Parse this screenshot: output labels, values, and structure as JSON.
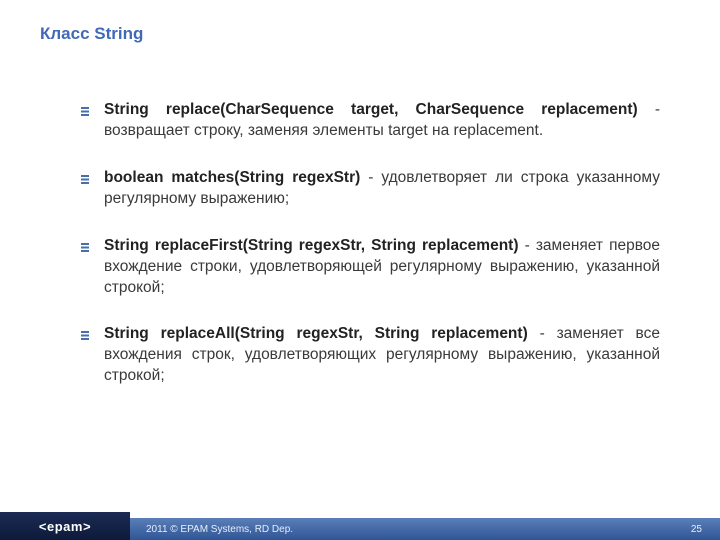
{
  "title": "Класс String",
  "items": [
    {
      "sig": "String replace(CharSequence target, CharSequence replacement)",
      "sep": " - ",
      "desc": "возвращает строку, заменяя элементы target на replacement."
    },
    {
      "sig": "boolean matches(String regexStr)",
      "sep": " - ",
      "desc": "удовлетворяет ли строка указанному регулярному выражению;"
    },
    {
      "sig": "String replaceFirst(String regexStr, String replacement)",
      "sep": " - ",
      "desc": "заменяет первое вхождение строки, удовлетворяющей регулярному выражению, указанной строкой;"
    },
    {
      "sig": "String replaceAll(String regexStr, String replacement)",
      "sep": " - ",
      "desc": "заменяет все вхождения строк, удовлетворяющих регулярному выражению, указанной строкой;"
    }
  ],
  "footer": {
    "logo": "<epam>",
    "copyright": "2011 © EPAM Systems, RD Dep.",
    "page": "25"
  }
}
